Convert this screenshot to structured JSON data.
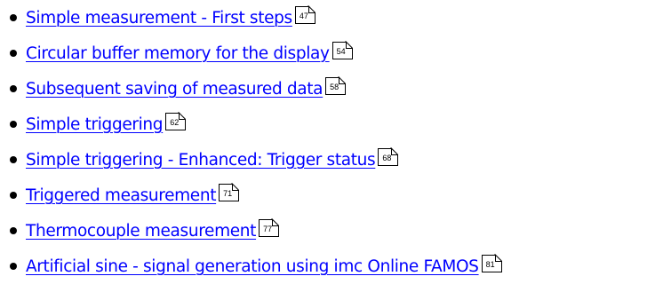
{
  "items": [
    {
      "label": "Simple measurement - First steps",
      "page": "47"
    },
    {
      "label": "Circular buffer memory for the display",
      "page": "54"
    },
    {
      "label": "Subsequent saving of measured data",
      "page": "58"
    },
    {
      "label": "Simple triggering",
      "page": "62"
    },
    {
      "label": "Simple triggering - Enhanced: Trigger status",
      "page": "68"
    },
    {
      "label": "Triggered measurement",
      "page": "71"
    },
    {
      "label": "Thermocouple measurement",
      "page": "77"
    },
    {
      "label": "Artificial sine - signal generation using imc Online FAMOS",
      "page": "81"
    }
  ],
  "colors": {
    "link": "#0000ff",
    "text": "#000000",
    "background": "#ffffff"
  }
}
